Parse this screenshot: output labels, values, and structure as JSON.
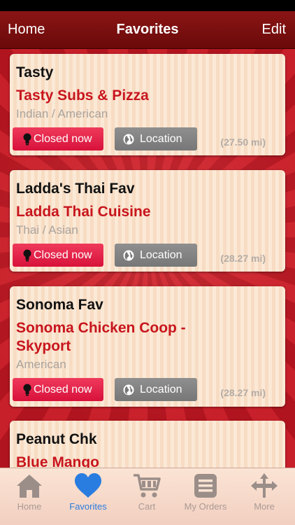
{
  "nav": {
    "left": "Home",
    "title": "Favorites",
    "right": "Edit"
  },
  "favorites": [
    {
      "nickname": "Tasty",
      "name": "Tasty Subs & Pizza",
      "cuisine": "Indian / American",
      "status": "Closed now",
      "location_label": "Location",
      "distance": "(27.50 mi)"
    },
    {
      "nickname": "Ladda's Thai Fav",
      "name": "Ladda Thai Cuisine",
      "cuisine": "Thai / Asian",
      "status": "Closed now",
      "location_label": "Location",
      "distance": "(28.27 mi)"
    },
    {
      "nickname": "Sonoma Fav",
      "name": "Sonoma Chicken Coop - Skyport",
      "cuisine": "American",
      "status": "Closed now",
      "location_label": "Location",
      "distance": "(28.27 mi)"
    },
    {
      "nickname": "Peanut Chk",
      "name": "Blue Mango",
      "cuisine": "",
      "status": "",
      "location_label": "",
      "distance": ""
    }
  ],
  "tabs": [
    {
      "label": "Home",
      "icon": "home-icon",
      "active": false
    },
    {
      "label": "Favorites",
      "icon": "heart-icon",
      "active": true
    },
    {
      "label": "Cart",
      "icon": "cart-icon",
      "active": false
    },
    {
      "label": "My Orders",
      "icon": "orders-icon",
      "active": false
    },
    {
      "label": "More",
      "icon": "more-icon",
      "active": false
    }
  ],
  "colors": {
    "nav_bg": "#7b1010",
    "restaurant_name": "#c8151d",
    "closed_button": "#e2244a",
    "location_button": "#828282",
    "tab_active": "#2a7de0",
    "tab_inactive": "#9b8e89"
  }
}
